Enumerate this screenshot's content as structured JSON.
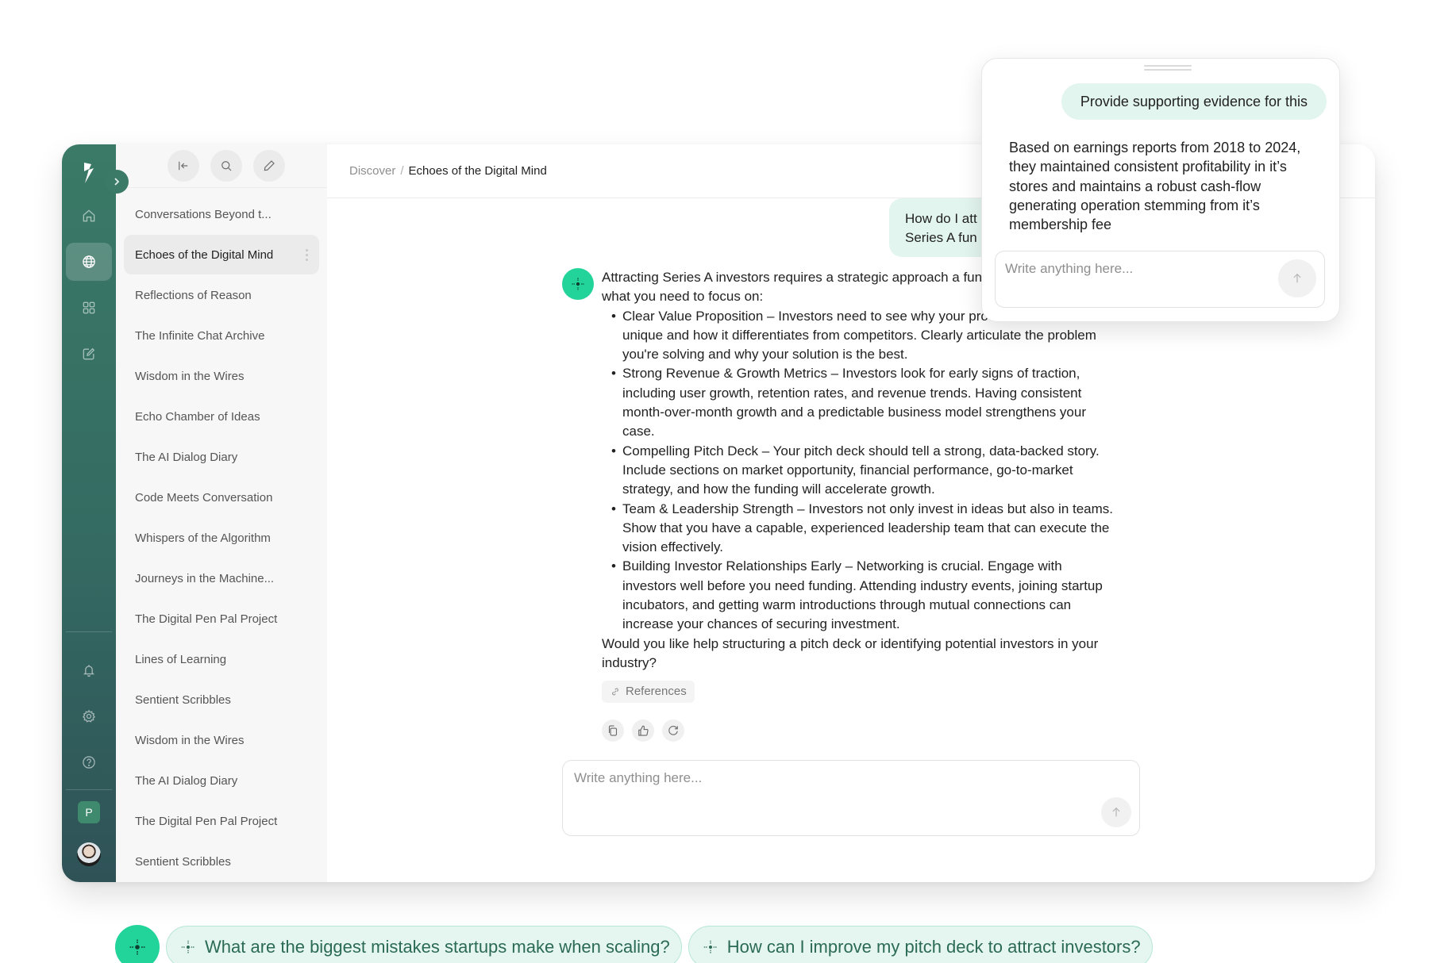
{
  "app": {
    "brand_icon": "lightning-bolt-logo"
  },
  "rail": {
    "items": [
      {
        "name": "home",
        "icon": "home-icon",
        "active": false
      },
      {
        "name": "discover",
        "icon": "globe-icon",
        "active": true
      },
      {
        "name": "apps",
        "icon": "grid-icon",
        "active": false
      },
      {
        "name": "new-note",
        "icon": "edit-square-icon",
        "active": false
      }
    ],
    "bottom_items": [
      {
        "name": "notifications",
        "icon": "bell-icon"
      },
      {
        "name": "settings",
        "icon": "gear-icon"
      },
      {
        "name": "help",
        "icon": "help-circle-icon"
      }
    ],
    "workspace_initial": "P",
    "expand_icon": "chevron-right-icon"
  },
  "list_panel": {
    "toolbar": [
      {
        "name": "collapse",
        "icon": "collapse-left-icon"
      },
      {
        "name": "search",
        "icon": "search-icon"
      },
      {
        "name": "new-chat",
        "icon": "pencil-icon"
      }
    ],
    "conversations": [
      {
        "title": "Conversations Beyond t...",
        "active": false
      },
      {
        "title": "Echoes of the Digital Mind",
        "active": true
      },
      {
        "title": "Reflections of Reason",
        "active": false
      },
      {
        "title": "The Infinite Chat Archive",
        "active": false
      },
      {
        "title": "Wisdom in the Wires",
        "active": false
      },
      {
        "title": "Echo Chamber of Ideas",
        "active": false
      },
      {
        "title": "The AI Dialog Diary",
        "active": false
      },
      {
        "title": "Code Meets Conversation",
        "active": false
      },
      {
        "title": "Whispers of the Algorithm",
        "active": false
      },
      {
        "title": "Journeys in the Machine...",
        "active": false
      },
      {
        "title": "The Digital Pen Pal Project",
        "active": false
      },
      {
        "title": "Lines of Learning",
        "active": false
      },
      {
        "title": "Sentient Scribbles",
        "active": false
      },
      {
        "title": "Wisdom in the Wires",
        "active": false
      },
      {
        "title": "The AI Dialog Diary",
        "active": false
      },
      {
        "title": "The Digital Pen Pal Project",
        "active": false
      },
      {
        "title": "Sentient Scribbles",
        "active": false
      }
    ]
  },
  "header": {
    "breadcrumb_root": "Discover",
    "breadcrumb_sep": "/",
    "breadcrumb_current": "Echoes of the Digital Mind"
  },
  "chat": {
    "user_message_line1": "How do I att",
    "user_message_line2": "Series A fun",
    "answer_intro": "Attracting Series A investors requires a strategic approach a fundamentals. Here’s what you need to focus on:",
    "bullets": [
      "Clear Value Proposition – Investors need to see why your product or service is unique and how it differentiates from competitors. Clearly articulate the problem you're solving and why your solution is the best.",
      "Strong Revenue & Growth Metrics – Investors look for early signs of traction, including user growth, retention rates, and revenue trends. Having consistent month-over-month growth and a predictable business model strengthens your case.",
      "Compelling Pitch Deck – Your pitch deck should tell a strong, data-backed story. Include sections on market opportunity, financial performance, go-to-market strategy, and how the funding will accelerate growth.",
      "Team & Leadership Strength – Investors not only invest in ideas but also in teams. Show that you have a capable, experienced leadership team that can execute the vision effectively.",
      "Building Investor Relationships Early – Networking is crucial. Engage with investors well before you need funding. Attending industry events, joining startup incubators, and getting warm introductions through mutual connections can increase your chances of securing investment."
    ],
    "answer_outro": "Would you like help structuring a pitch deck or identifying potential investors in your industry?",
    "references_label": "References",
    "actions": [
      {
        "name": "copy",
        "icon": "copy-icon"
      },
      {
        "name": "like",
        "icon": "thumbs-up-icon"
      },
      {
        "name": "regenerate",
        "icon": "refresh-icon"
      }
    ],
    "composer_placeholder": "Write anything here..."
  },
  "popup": {
    "user_message": "Provide supporting evidence for this",
    "answer": "Based on earnings reports from 2018 to 2024, they maintained consistent profitability in it’s stores and maintains a robust cash-flow generating operation stemming from it’s membership fee",
    "composer_placeholder": "Write anything here..."
  },
  "suggestions": [
    "What are the biggest mistakes startups make when scaling?",
    "How can I improve my pitch deck to attract investors?"
  ],
  "colors": {
    "brand_green": "#22d39a",
    "rail_top": "#3b7a67",
    "rail_bottom": "#2f5257",
    "bubble_bg": "#e3f5ef",
    "chip_text": "#2b6a55"
  }
}
